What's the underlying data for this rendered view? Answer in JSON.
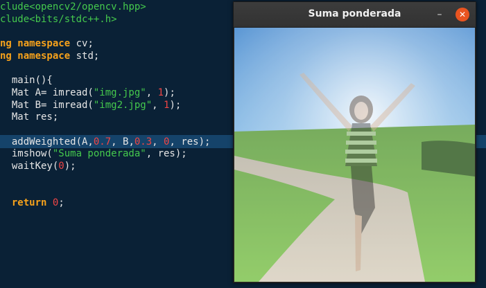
{
  "code": {
    "lines": [
      {
        "t": [
          [
            "inc",
            "clude"
          ],
          [
            "str",
            "<opencv2/opencv.hpp>"
          ]
        ]
      },
      {
        "t": [
          [
            "inc",
            "clude"
          ],
          [
            "str",
            "<bits/stdc++.h>"
          ]
        ]
      },
      {
        "t": []
      },
      {
        "t": [
          [
            "kw",
            "ng namespace"
          ],
          [
            "plain",
            " cv;"
          ]
        ]
      },
      {
        "t": [
          [
            "kw",
            "ng namespace"
          ],
          [
            "plain",
            " std;"
          ]
        ]
      },
      {
        "t": []
      },
      {
        "t": [
          [
            "plain",
            "  main(){"
          ]
        ]
      },
      {
        "t": [
          [
            "plain",
            "  Mat A= imread("
          ],
          [
            "str",
            "\"img.jpg\""
          ],
          [
            "plain",
            ", "
          ],
          [
            "num",
            "1"
          ],
          [
            "plain",
            ");"
          ]
        ]
      },
      {
        "t": [
          [
            "plain",
            "  Mat B= imread("
          ],
          [
            "str",
            "\"img2.jpg\""
          ],
          [
            "plain",
            ", "
          ],
          [
            "num",
            "1"
          ],
          [
            "plain",
            ");"
          ]
        ]
      },
      {
        "t": [
          [
            "plain",
            "  Mat res;"
          ]
        ]
      },
      {
        "t": []
      },
      {
        "t": [
          [
            "plain",
            "  addWeighted(A,"
          ],
          [
            "num",
            "0.7"
          ],
          [
            "plain",
            ", B,"
          ],
          [
            "num",
            "0.3"
          ],
          [
            "plain",
            ", "
          ],
          [
            "num",
            "0"
          ],
          [
            "plain",
            ", res);"
          ]
        ]
      },
      {
        "t": [
          [
            "plain",
            "  imshow("
          ],
          [
            "str",
            "\"Suma ponderada\""
          ],
          [
            "plain",
            ", res);"
          ]
        ]
      },
      {
        "t": [
          [
            "plain",
            "  waitKey("
          ],
          [
            "num",
            "0"
          ],
          [
            "plain",
            ");"
          ]
        ]
      },
      {
        "t": []
      },
      {
        "t": []
      },
      {
        "t": [
          [
            "kw",
            "  return"
          ],
          [
            "plain",
            " "
          ],
          [
            "num",
            "0"
          ],
          [
            "plain",
            ";"
          ]
        ]
      }
    ]
  },
  "window": {
    "title": "Suma ponderada",
    "minimize_symbol": "–",
    "close_symbol": "✕"
  },
  "colors": {
    "keyword": "#f7a21b",
    "string": "#45c94d",
    "number": "#f04545",
    "highlight": "#15436a",
    "close": "#e95420"
  }
}
